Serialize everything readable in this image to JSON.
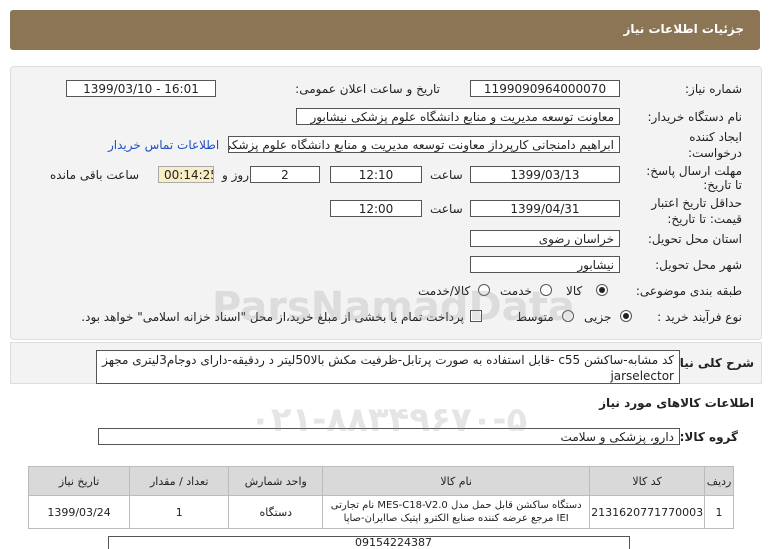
{
  "header": {
    "title": "جزئیات اطلاعات نیاز"
  },
  "form": {
    "need_number_label": "شماره نیاز:",
    "need_number": "1199090964000070",
    "announce_label": "تاریخ و ساعت اعلان عمومی:",
    "announce_value": "1399/03/10 - 16:01",
    "buyer_label": "نام دستگاه خریدار:",
    "buyer_value": "معاونت توسعه مدیریت و منابع دانشگاه علوم پزشکی نیشابور",
    "creator_label_1": "ایجاد کننده",
    "creator_label_2": "درخواست:",
    "creator_value": "ابراهیم دامنجانی  کارپرداز معاونت توسعه مدیریت و منابع دانشگاه علوم پزشکی",
    "contact_link": "اطلاعات تماس خریدار",
    "deadline_label_1": "مهلت ارسال پاسخ:",
    "deadline_label_2": "تا تاریخ:",
    "deadline_date": "1399/03/13",
    "time_label": "ساعت",
    "deadline_time": "12:10",
    "days_value": "2",
    "days_label": "روز و",
    "remaining_time": "00:14:25",
    "remaining_label": "ساعت باقی مانده",
    "validity_label_1": "حداقل تاریخ اعتبار",
    "validity_label_2": "قیمت: تا تاریخ:",
    "validity_date": "1399/04/31",
    "validity_time": "12:00",
    "province_label": "استان محل تحویل:",
    "province_value": "خراسان رضوی",
    "city_label": "شهر محل تحویل:",
    "city_value": "نیشابور",
    "category_label": "طبقه بندی موضوعی:",
    "category_options": [
      "کالا",
      "خدمت",
      "کالا/خدمت"
    ],
    "process_label": "نوع فرآیند خرید :",
    "process_options": [
      "جزیی",
      "متوسط"
    ],
    "payment_note": "پرداخت تمام یا بخشی از مبلغ خرید،از محل \"اسناد خزانه اسلامی\" خواهد بود."
  },
  "description": {
    "label": "شرح کلی نیاز:",
    "text": "کد مشابه-ساکشن c55 -قابل استفاده به صورت پرتابل-ظرفیت مکش بالا50لیتر د ردقیقه-دارای دوجام3لیتری مجهز jarselector"
  },
  "items_section": {
    "title": "اطلاعات کالاهای مورد نیاز",
    "group_label": "گروه کالا:",
    "group_value": "دارو، پزشکی و سلامت",
    "columns": [
      "ردیف",
      "کد کالا",
      "نام کالا",
      "واحد شمارش",
      "تعداد / مقدار",
      "تاریخ نیاز"
    ],
    "rows": [
      {
        "index": "1",
        "code": "2131620771770003",
        "name": "دستگاه ساکشن قابل حمل مدل MES-C18-V2.0 نام تجارتی IEI مرجع عرضه کننده صنایع الکترو اپتیک صاایران-صاپا",
        "unit": "دستگاه",
        "qty": "1",
        "date": "1399/03/24"
      }
    ],
    "bottom_text": "09154224387"
  },
  "watermark": {
    "brand": "ParsNamadData",
    "phone": "۰۲۱-۸۸۳۴۹۶۷۰-۵"
  }
}
